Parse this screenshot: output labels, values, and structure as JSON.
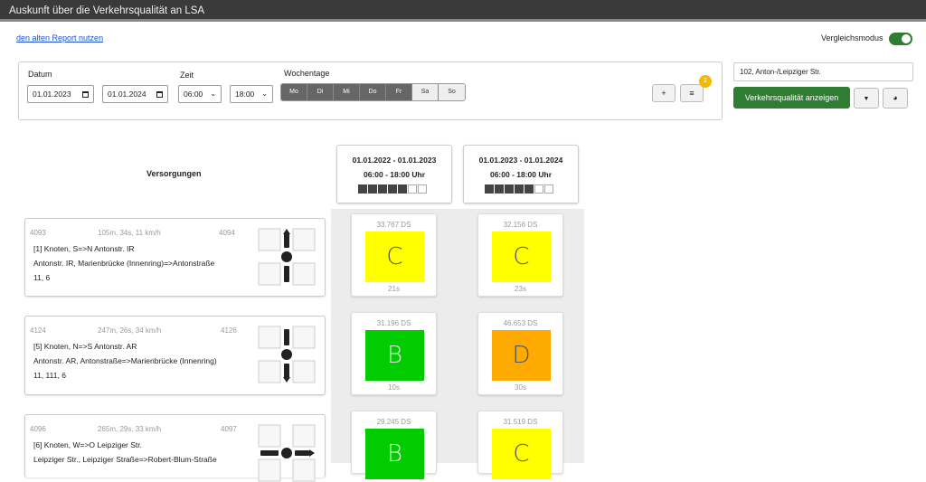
{
  "app": {
    "title": "Auskunft über die Verkehrsqualität an LSA"
  },
  "links": {
    "old_report": "den alten Report nutzen"
  },
  "compare": {
    "label": "Vergleichsmodus",
    "enabled": true
  },
  "filters": {
    "date_label": "Datum",
    "date_from": "01.01.2023",
    "date_to": "01.01.2024",
    "time_label": "Zeit",
    "time_from": "06:00",
    "time_to": "18:00",
    "weekdays_label": "Wochentage",
    "weekdays": [
      {
        "label": "Mo",
        "selected": true
      },
      {
        "label": "Di",
        "selected": true
      },
      {
        "label": "Mi",
        "selected": true
      },
      {
        "label": "Do",
        "selected": true
      },
      {
        "label": "Fr",
        "selected": true
      },
      {
        "label": "Sa",
        "selected": false
      },
      {
        "label": "So",
        "selected": false
      }
    ],
    "add_label": "+",
    "list_label": "≡",
    "badge_count": "2"
  },
  "node": {
    "value": "102, Anton-/Leipziger Str."
  },
  "actions": {
    "show_label": "Verkehrsqualität anzeigen",
    "filter_icon": "▼",
    "chart_icon": "◕"
  },
  "section": {
    "versorgungen": "Versorgungen"
  },
  "periods": [
    {
      "dates": "01.01.2022 - 01.01.2023",
      "times": "06:00 - 18:00 Uhr"
    },
    {
      "dates": "01.01.2023 - 01.01.2024",
      "times": "06:00 - 18:00 Uhr"
    }
  ],
  "colors": {
    "A": "#00cc00",
    "B": "#00cc00",
    "C": "#ffff00",
    "D": "#ffaa00",
    "accent": "#2e7d32"
  },
  "rows": [
    {
      "from": "4093",
      "info": "105m, 34s, 11 km/h",
      "to": "4094",
      "line1": "[1] Knoten, S=>N Antonstr. IR",
      "line2": "Antonstr. IR,  Marienbrücke (Innenring)=>Antonstraße",
      "line3": "11, 6",
      "icon": "arrow-north-icon",
      "cells": [
        {
          "ds": "33.767 DS",
          "grade": "C",
          "wait": "21s"
        },
        {
          "ds": "32.156 DS",
          "grade": "C",
          "wait": "23s"
        }
      ]
    },
    {
      "from": "4124",
      "info": "247m, 26s, 34 km/h",
      "to": "4126",
      "line1": "[5] Knoten, N=>S Antonstr. AR",
      "line2": "Antonstr. AR,  Antonstraße=>Marienbrücke (Innenring)",
      "line3": "11, 111, 6",
      "icon": "arrow-south-icon",
      "cells": [
        {
          "ds": "31.196 DS",
          "grade": "B",
          "wait": "10s"
        },
        {
          "ds": "46.653 DS",
          "grade": "D",
          "wait": "30s"
        }
      ]
    },
    {
      "from": "4096",
      "info": "265m, 29s, 33 km/h",
      "to": "4097",
      "line1": "[6] Knoten, W=>O Leipziger Str.",
      "line2": "Leipziger Str.,  Leipziger Straße=>Robert-Blum-Straße",
      "line3": "",
      "icon": "arrow-east-icon",
      "cells": [
        {
          "ds": "29.245 DS",
          "grade": "B",
          "wait": ""
        },
        {
          "ds": "31.519 DS",
          "grade": "C",
          "wait": ""
        }
      ]
    }
  ]
}
